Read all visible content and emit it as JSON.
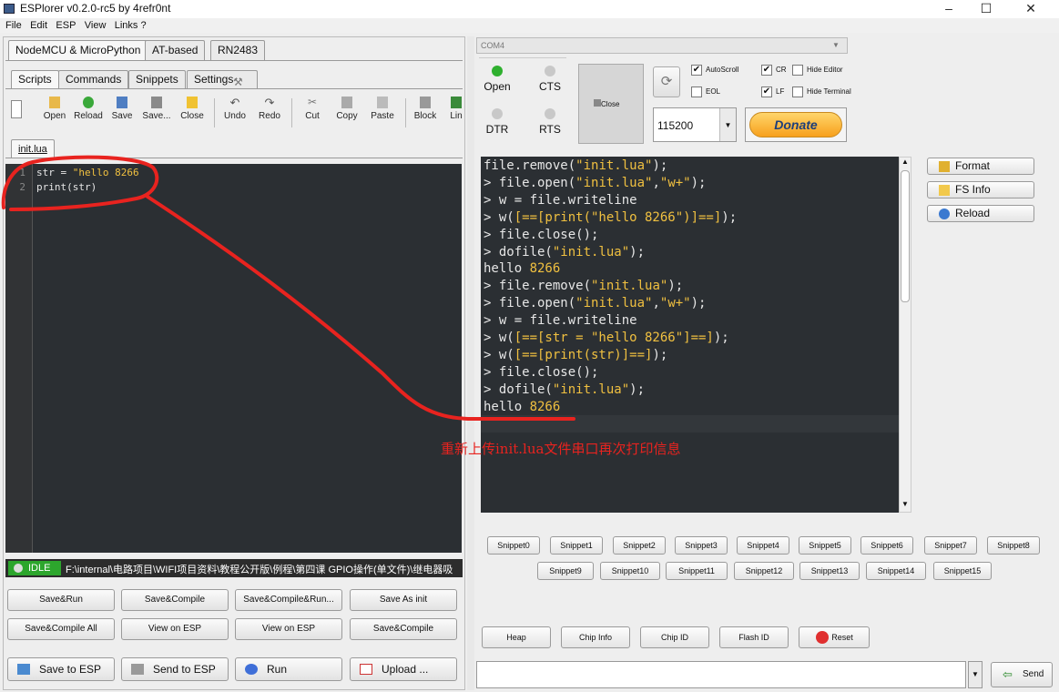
{
  "window": {
    "title": "ESPlorer v0.2.0-rc5 by 4refr0nt",
    "min": "–",
    "max": "☐",
    "close": "✕"
  },
  "menu": [
    "File",
    "Edit",
    "ESP",
    "View",
    "Links ?"
  ],
  "left": {
    "top_tabs": [
      "NodeMCU & MicroPython",
      "AT-based",
      "RN2483"
    ],
    "sub_tabs": [
      "Scripts",
      "Commands",
      "Snippets",
      "Settings"
    ],
    "toolbar": [
      "Open",
      "Reload",
      "Save",
      "Save...",
      "Close",
      "Undo",
      "Redo",
      "Cut",
      "Copy",
      "Paste",
      "Block",
      "Lin"
    ],
    "file_tab": "init.lua",
    "code": {
      "line1_num": "1",
      "line1_pre": "str = ",
      "line1_str": "\"hello 8266",
      "line2_num": "2",
      "line2": "print(str)"
    },
    "status": {
      "state": "IDLE",
      "path": "F:\\internal\\电路项目\\WIFI项目资料\\教程公开版\\例程\\第四课 GPIO操作(单文件)\\继电器吸"
    },
    "buttons_row1": [
      "Save&Run",
      "Save&Compile",
      "Save&Compile&Run...",
      "Save As init"
    ],
    "buttons_row2": [
      "Save&Compile All",
      "View on ESP",
      "View on ESP",
      "Save&Compile"
    ],
    "bottom": [
      "Save to ESP",
      "Send to ESP",
      "Run",
      "Upload ..."
    ]
  },
  "right": {
    "port": "COM4",
    "open": "Open",
    "cts": "CTS",
    "close": "Close",
    "dtr": "DTR",
    "rts": "RTS",
    "checks": {
      "autoscroll": "AutoScroll",
      "cr": "CR",
      "hide_editor": "Hide Editor",
      "eol": "EOL",
      "lf": "LF",
      "hide_terminal": "Hide Terminal"
    },
    "baud": "115200",
    "donate": "Donate",
    "terminal": [
      {
        "a": "file.remove(",
        "s": "\"init.lua\"",
        "b": ");"
      },
      {
        "a": "> file.open(",
        "s": "\"init.lua\"",
        "m": ",",
        "s2": "\"w+\"",
        "b": ");"
      },
      {
        "a": "> w = file.writeline"
      },
      {
        "a": "> w(",
        "s": "[==[print(\"hello 8266\")]==]",
        "b": ");"
      },
      {
        "a": "> file.close();"
      },
      {
        "a": "> dofile(",
        "s": "\"init.lua\"",
        "b": ");"
      },
      {
        "a": "hello ",
        "s": "8266"
      },
      {
        "a": "> file.remove(",
        "s": "\"init.lua\"",
        "b": ");"
      },
      {
        "a": "> file.open(",
        "s": "\"init.lua\"",
        "m": ",",
        "s2": "\"w+\"",
        "b": ");"
      },
      {
        "a": "> w = file.writeline"
      },
      {
        "a": "> w(",
        "s": "[==[str = \"hello 8266\"]==]",
        "b": ");"
      },
      {
        "a": "> w(",
        "s": "[==[print(str)]==]",
        "b": ");"
      },
      {
        "a": "> file.close();"
      },
      {
        "a": "> dofile(",
        "s": "\"init.lua\"",
        "b": ");"
      },
      {
        "a": "hello ",
        "s": "8266"
      },
      {
        "a": ">"
      }
    ],
    "annotation": "重新上传init.lua文件串口再次打印信息",
    "side": [
      "Format",
      "FS Info",
      "Reload"
    ],
    "snippets_row1": [
      "Snippet0",
      "Snippet1",
      "Snippet2",
      "Snippet3",
      "Snippet4",
      "Snippet5",
      "Snippet6",
      "Snippet7",
      "Snippet8"
    ],
    "snippets_row2": [
      "Snippet9",
      "Snippet10",
      "Snippet11",
      "Snippet12",
      "Snippet13",
      "Snippet14",
      "Snippet15"
    ],
    "bottom": [
      "Heap",
      "Chip Info",
      "Chip ID",
      "Flash ID",
      "Reset"
    ],
    "send": "Send"
  },
  "colors": {
    "annotation": "#e8231f",
    "string": "#f0c040",
    "editor_bg": "#2b2f33",
    "donate": "#f7a01c"
  }
}
